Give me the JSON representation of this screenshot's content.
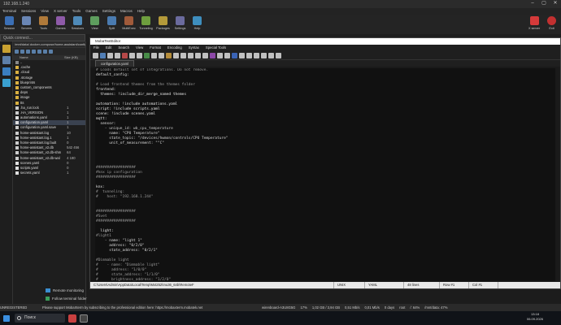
{
  "app": {
    "title": "192.168.1.240",
    "window_controls": [
      "–",
      "▢",
      "✕"
    ]
  },
  "menu": [
    "Terminal",
    "Sessions",
    "View",
    "X server",
    "Tools",
    "Games",
    "Settings",
    "Macros",
    "Help"
  ],
  "toolbar": [
    {
      "label": "Session",
      "color": "#3b6fb5"
    },
    {
      "label": "Servers",
      "color": "#6a86b4"
    },
    {
      "label": "Tools",
      "color": "#b07a3a"
    },
    {
      "label": "Games",
      "color": "#8e5aa8"
    },
    {
      "label": "Sessions",
      "color": "#4f8ab8"
    },
    {
      "label": "View",
      "color": "#5e9e5e"
    },
    {
      "label": "Split",
      "color": "#4a7bb0"
    },
    {
      "label": "MultiExec",
      "color": "#a05a3a"
    },
    {
      "label": "Tunneling",
      "color": "#6e9e3e"
    },
    {
      "label": "Packages",
      "color": "#b49a3a"
    },
    {
      "label": "Settings",
      "color": "#6b6b9e"
    },
    {
      "label": "Help",
      "color": "#3e8ebe"
    }
  ],
  "toolbar_right": [
    {
      "label": "X server",
      "color": "#d53a3a"
    },
    {
      "label": "Exit",
      "color": "#c23030"
    }
  ],
  "quick_connect": "Quick connect...",
  "file_panel": {
    "path": "/mnt/data/.docker-compose/home-assistant/config/home",
    "columns": {
      "name": "Name",
      "size": "Size (KB)"
    },
    "items": [
      {
        "name": "..",
        "size": "",
        "type": "up"
      },
      {
        "name": ".cache",
        "size": "",
        "type": "folder"
      },
      {
        "name": ".cloud",
        "size": "",
        "type": "folder"
      },
      {
        "name": ".storage",
        "size": "",
        "type": "folder"
      },
      {
        "name": "blueprints",
        "size": "",
        "type": "folder"
      },
      {
        "name": "custom_components",
        "size": "",
        "type": "folder"
      },
      {
        "name": "deps",
        "size": "",
        "type": "folder"
      },
      {
        "name": "image",
        "size": "",
        "type": "folder"
      },
      {
        "name": "tts",
        "size": "",
        "type": "folder"
      },
      {
        "name": ".ha_run.lock",
        "size": "1",
        "type": "file"
      },
      {
        "name": ".HA_VERSION",
        "size": "1",
        "type": "file"
      },
      {
        "name": "automations.yaml",
        "size": "1",
        "type": "yaml"
      },
      {
        "name": "configuration.yaml",
        "size": "1",
        "type": "yaml",
        "selected": true
      },
      {
        "name": "configuration.yaml.save",
        "size": "1",
        "type": "file"
      },
      {
        "name": "home-assistant.log",
        "size": "10",
        "type": "file"
      },
      {
        "name": "home-assistant.log.1",
        "size": "1",
        "type": "file"
      },
      {
        "name": "home-assistant.log.fault",
        "size": "0",
        "type": "file"
      },
      {
        "name": "home-assistant_v2.db",
        "size": "542 456",
        "type": "file"
      },
      {
        "name": "home-assistant_v2.db-shm",
        "size": "64",
        "type": "file"
      },
      {
        "name": "home-assistant_v2.db-wal",
        "size": "4 180",
        "type": "file"
      },
      {
        "name": "scenes.yaml",
        "size": "0",
        "type": "yaml"
      },
      {
        "name": "scripts.yaml",
        "size": "0",
        "type": "yaml"
      },
      {
        "name": "secrets.yaml",
        "size": "1",
        "type": "yaml"
      }
    ],
    "remote_monitoring": "Remote monitoring",
    "follow_terminal": "Follow terminal folder"
  },
  "editor": {
    "title": "MobaTextEditor",
    "menu": [
      "File",
      "Edit",
      "Search",
      "View",
      "Format",
      "Encoding",
      "Syntax",
      "Special Tools"
    ],
    "tab": "configuration.yaml",
    "lines": [
      "# Loads default set of integrations. Do not remove.",
      "default_config:",
      "",
      "# Load frontend themes from the themes folder",
      "frontend:",
      "  themes: !include_dir_merge_named themes",
      "",
      "automation: !include automations.yaml",
      "script: !include scripts.yaml",
      "scene: !include scenes.yaml",
      "mqtt:",
      "  sensor:",
      "    - unique_id: wb_cpu_temperature",
      "      name: \"CPU Temperature\"",
      "      state_topic: \"/devices/hwmon/controls/CPU Temperature\"",
      "      unit_of_measurement: \"°C\"",
      "",
      "",
      "",
      "",
      "##################",
      "#knx ip configuration",
      "##################",
      "",
      "knx:",
      "#  tunneling:",
      "#    host: \"192.168.1.244\"",
      "",
      "",
      "##################",
      "#Svet",
      "##################",
      "",
      "  light:",
      "#light1",
      "    - name: \"light 1\"",
      "      address: \"0/2/0\"",
      "      state_address: \"0/2/1\"",
      "",
      "#Dimmable light",
      "#    - name: \"Dimmable light\"",
      "#      address: \"1/0/0\"",
      "#      state_address: \"1/1/0\"",
      "#      brightness_address: \"1/2/0\"",
      "#      brightness_state_address: \"1/3/0\""
    ],
    "status": {
      "path": "C:\\Users\\Admin\\AppData\\Local\\Temp\\Mxt252\\mu36_64b\\RemoteF",
      "format": "UNIX",
      "syntax": "YAML",
      "lines": "48 lines",
      "row": "Row #1",
      "col": "Col #1"
    }
  },
  "monitor": {
    "unregistered": "UNREGISTERED VERSION",
    "notice": "Please support MobaXterm by subscribing to the professional edition here: https://mobaxterm.mobatek.net",
    "items": [
      "wirenboard-A3U8G5G",
      "17%",
      "1,02 GB / 3,94 GB",
      "0,51 Mb/s",
      "0,01 Mb/s",
      "0 days",
      "root",
      "/: 64%",
      "/mnt/data: 47%"
    ]
  },
  "taskbar": {
    "search_placeholder": "Поиск",
    "time": "13:18",
    "date": "06.09.2026"
  }
}
